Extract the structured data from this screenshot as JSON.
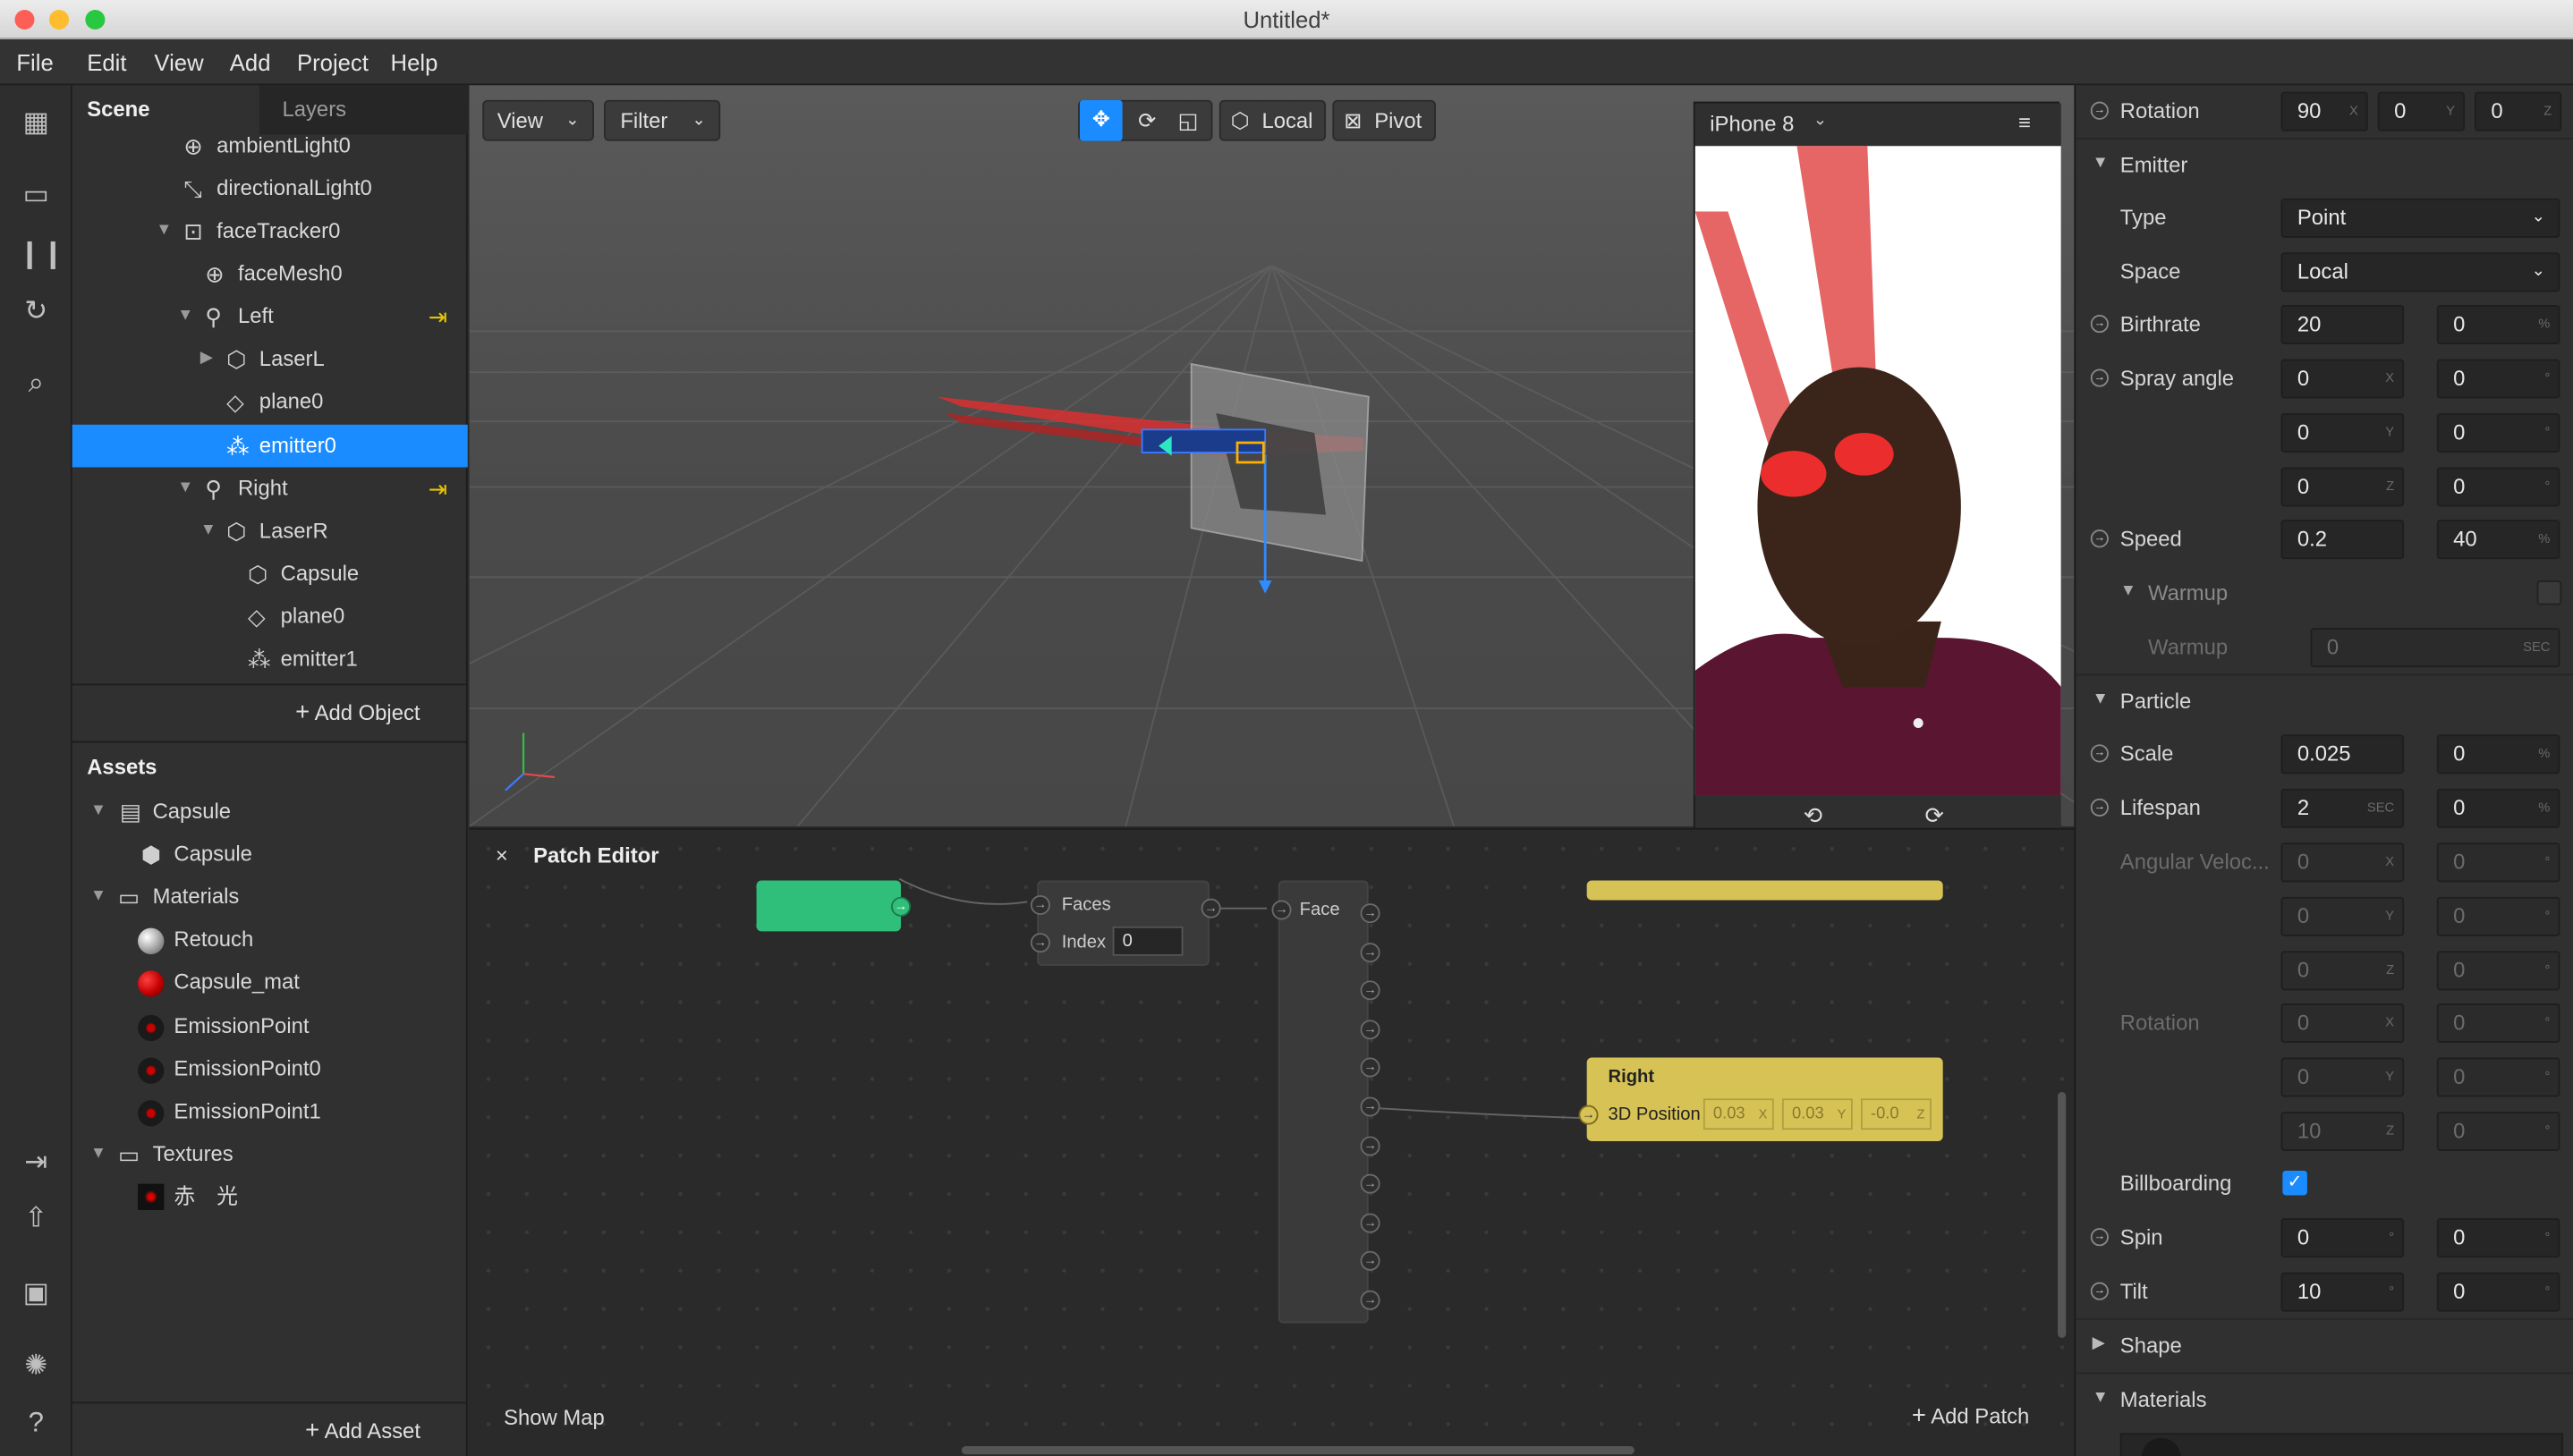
{
  "window": {
    "title": "Untitled*"
  },
  "menu": [
    "File",
    "Edit",
    "View",
    "Add",
    "Project",
    "Help"
  ],
  "scene": {
    "tabs": [
      "Scene",
      "Layers"
    ],
    "items": [
      {
        "label": "ambientLight0",
        "icon": "globe-icon"
      },
      {
        "label": "directionalLight0",
        "icon": "directional-light-icon"
      },
      {
        "label": "faceTracker0",
        "icon": "face-tracker-icon"
      },
      {
        "label": "faceMesh0",
        "icon": "mesh-icon"
      },
      {
        "label": "Left",
        "icon": "null-object-icon"
      },
      {
        "label": "LaserL",
        "icon": "cube-icon"
      },
      {
        "label": "plane0",
        "icon": "plane-icon"
      },
      {
        "label": "emitter0",
        "icon": "emitter-icon"
      },
      {
        "label": "Right",
        "icon": "null-object-icon"
      },
      {
        "label": "LaserR",
        "icon": "cube-icon"
      },
      {
        "label": "Capsule",
        "icon": "cube-icon"
      },
      {
        "label": "plane0",
        "icon": "plane-icon"
      },
      {
        "label": "emitter1",
        "icon": "emitter-icon"
      }
    ],
    "add_object": "Add Object"
  },
  "assets": {
    "title": "Assets",
    "items": [
      {
        "label": "Capsule",
        "icon": "file-icon"
      },
      {
        "label": "Capsule",
        "icon": "cube-icon"
      },
      {
        "label": "Materials",
        "icon": "folder-icon"
      },
      {
        "label": "Retouch",
        "icon": "material-sphere-icon",
        "color": "#bdbdbd"
      },
      {
        "label": "Capsule_mat",
        "icon": "material-sphere-icon",
        "color": "#c40000"
      },
      {
        "label": "EmissionPoint",
        "icon": "material-sphere-icon",
        "color": "#1a1a1a"
      },
      {
        "label": "EmissionPoint0",
        "icon": "material-sphere-icon",
        "color": "#1a1a1a"
      },
      {
        "label": "EmissionPoint1",
        "icon": "material-sphere-icon",
        "color": "#1a1a1a"
      },
      {
        "label": "Textures",
        "icon": "folder-icon"
      },
      {
        "label": "赤　光",
        "icon": "texture-icon"
      }
    ],
    "add_asset": "Add Asset"
  },
  "viewport": {
    "view_label": "View",
    "filter_label": "Filter",
    "local_label": "Local",
    "pivot_label": "Pivot"
  },
  "preview": {
    "device": "iPhone 8"
  },
  "patch_editor": {
    "title": "Patch Editor",
    "faces_label": "Faces",
    "index_label": "Index",
    "index_value": "0",
    "face_label": "Face",
    "right_node": {
      "title": "Right",
      "port": "3D Position",
      "x": "0.03",
      "y": "0.03",
      "z": "-0.0"
    },
    "show_map": "Show Map",
    "add_patch": "Add Patch"
  },
  "properties": {
    "rotation": {
      "label": "Rotation",
      "x": "90",
      "y": "0",
      "z": "0"
    },
    "emitter_header": "Emitter",
    "type": {
      "label": "Type",
      "value": "Point"
    },
    "space": {
      "label": "Space",
      "value": "Local"
    },
    "birthrate": {
      "label": "Birthrate",
      "value": "20",
      "var": "0",
      "unit": "%"
    },
    "spray_angle": {
      "label": "Spray angle",
      "x": "0",
      "y": "0",
      "z": "0",
      "vx": "0",
      "vy": "0",
      "vz": "0"
    },
    "speed": {
      "label": "Speed",
      "value": "0.2",
      "var": "40",
      "unit": "%"
    },
    "warmup_header": "Warmup",
    "warmup": {
      "label": "Warmup",
      "value": "0",
      "unit": "SEC"
    },
    "particle_header": "Particle",
    "scale": {
      "label": "Scale",
      "value": "0.025",
      "var": "0",
      "unit": "%"
    },
    "lifespan": {
      "label": "Lifespan",
      "value": "2",
      "unit": "SEC",
      "var": "0",
      "var_unit": "%"
    },
    "angular_velocity": {
      "label": "Angular Veloc...",
      "x": "0",
      "y": "0",
      "z": "0",
      "vx": "0",
      "vy": "0",
      "vz": "0"
    },
    "rotation2": {
      "label": "Rotation",
      "x": "0",
      "y": "0",
      "z": "10",
      "vx": "0",
      "vy": "0",
      "vz": "0"
    },
    "billboarding": {
      "label": "Billboarding",
      "checked": true
    },
    "spin": {
      "label": "Spin",
      "value": "0",
      "var": "0"
    },
    "tilt": {
      "label": "Tilt",
      "value": "10",
      "var": "0"
    },
    "shape_header": "Shape",
    "materials_header": "Materials"
  },
  "colors": {
    "accent": "#1a8cff",
    "patch_green": "#2fbf7a",
    "patch_yellow": "#d7c255"
  }
}
